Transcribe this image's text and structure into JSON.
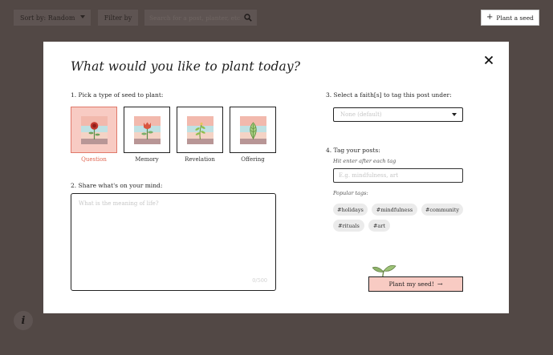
{
  "toolbar": {
    "sort_label": "Sort by:",
    "sort_value": "Random",
    "filter_label": "Filter by",
    "search_placeholder": "Search for a post, planter, etc",
    "plant_seed_label": "Plant a seed",
    "plant_seed_icon": "plus-icon",
    "info_label": "i"
  },
  "modal": {
    "title": "What would you like to plant today?",
    "close_icon": "close-icon",
    "step1_label": "1. Pick a type of seed to plant:",
    "seed_types": [
      {
        "label": "Question",
        "selected": true,
        "icon": "rose-flower-icon"
      },
      {
        "label": "Memory",
        "selected": false,
        "icon": "tulip-flower-icon"
      },
      {
        "label": "Revelation",
        "selected": false,
        "icon": "sprig-icon"
      },
      {
        "label": "Offering",
        "selected": false,
        "icon": "leaf-icon"
      }
    ],
    "step2_label": "2. Share what's on your mind:",
    "textarea_placeholder": "What is the meaning of life?",
    "char_count": "0/500",
    "step3_label": "3. Select a faith[s] to tag this post under:",
    "faith_select_value": "None (default)",
    "step4_label": "4. Tag your posts:",
    "tag_hint": "Hit enter after each tag",
    "tag_placeholder": "E.g. mindfulness, art",
    "popular_tags_label": "Popular tags:",
    "popular_tags": [
      "#holidays",
      "#mindfulness",
      "#community",
      "#rituals",
      "#art"
    ],
    "submit_label": "Plant my seed!",
    "submit_icon": "arrow-right-icon",
    "sprout_icon": "sprout-icon"
  },
  "colors": {
    "backdrop": "#524845",
    "accent_pink": "#f8cbc3",
    "accent_red": "#e0644f"
  }
}
